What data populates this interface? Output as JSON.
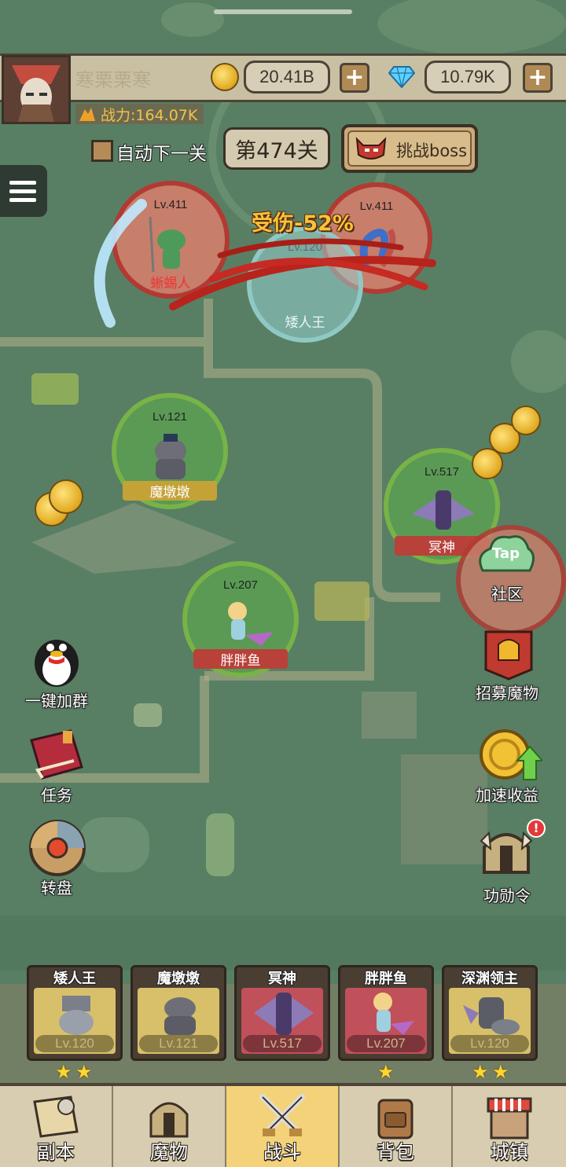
{
  "player": {
    "name": "寒栗栗寒",
    "power": "战力:164.07K"
  },
  "currency": {
    "gold": "20.41B",
    "diamond": "10.79K"
  },
  "stage": {
    "auto_next": "自动下一关",
    "level": "第474关",
    "boss_button": "挑战boss"
  },
  "battle": {
    "damage_text": "受伤-52%"
  },
  "enemies": [
    {
      "level": "Lv.411",
      "name": "蜥蜴人"
    },
    {
      "level": "Lv.411",
      "name": ""
    }
  ],
  "allies": [
    {
      "level": "Lv.120",
      "name": "矮人王"
    },
    {
      "level": "Lv.121",
      "name": "魔墩墩"
    },
    {
      "level": "Lv.517",
      "name": "冥神"
    },
    {
      "level": "Lv.207",
      "name": "胖胖鱼"
    }
  ],
  "side_left": [
    {
      "label": "一键加群",
      "icon": "penguin-icon"
    },
    {
      "label": "任务",
      "icon": "quest-book-icon"
    },
    {
      "label": "转盘",
      "icon": "wheel-icon"
    }
  ],
  "side_right": [
    {
      "label": "社区",
      "icon": "tap-community-icon",
      "badge": "Tap"
    },
    {
      "label": "招募魔物",
      "icon": "recruit-banner-icon"
    },
    {
      "label": "加速收益",
      "icon": "coin-boost-icon"
    },
    {
      "label": "功勋令",
      "icon": "helmet-icon",
      "alert": "!"
    }
  ],
  "team": [
    {
      "name": "矮人王",
      "level": "Lv.120",
      "stars": 2
    },
    {
      "name": "魔墩墩",
      "level": "Lv.121",
      "stars": 0
    },
    {
      "name": "冥神",
      "level": "Lv.517",
      "stars": 0
    },
    {
      "name": "胖胖鱼",
      "level": "Lv.207",
      "stars": 1
    },
    {
      "name": "深渊领主",
      "level": "Lv.120",
      "stars": 2
    }
  ],
  "tabs": [
    {
      "label": "副本",
      "icon": "map-scroll-icon"
    },
    {
      "label": "魔物",
      "icon": "monster-helmet-icon"
    },
    {
      "label": "战斗",
      "icon": "crossed-swords-icon",
      "active": true
    },
    {
      "label": "背包",
      "icon": "backpack-icon"
    },
    {
      "label": "城镇",
      "icon": "shop-icon"
    }
  ],
  "colors": {
    "map_bg": "#587f63",
    "enemy_ring": "#c8403c",
    "ally_ring": "#7fbf4a",
    "gold": "#e8b62a",
    "active_tab": "#f3d27a"
  }
}
